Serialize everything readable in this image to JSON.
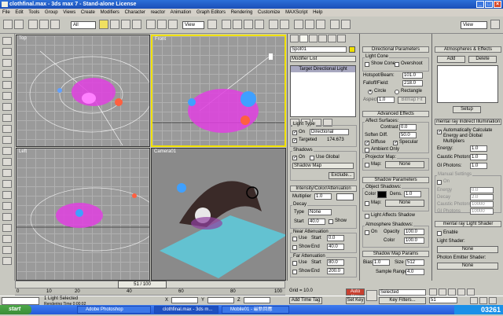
{
  "window": {
    "title": "clothfinal.max - 3ds max 7 - Stand-alone License"
  },
  "menu": [
    "File",
    "Edit",
    "Tools",
    "Group",
    "Views",
    "Create",
    "Modifiers",
    "Character",
    "reactor",
    "Animation",
    "Graph Editors",
    "Rendering",
    "Customize",
    "MAXScript",
    "Help"
  ],
  "toolbar": {
    "selection_filter": "All",
    "ref_coord": "View",
    "named_sel": "View"
  },
  "viewports": {
    "top": "Top",
    "front": "Front",
    "left": "Left",
    "camera": "Camera01"
  },
  "modify": {
    "object_name": "Spot01",
    "modifier_list": "Modifier List",
    "stack_item": "Target Directional Light",
    "light_type_header": "Light Type",
    "on_label": "On",
    "light_type_value": "Directional",
    "targeted_label": "Targeted",
    "targeted_value": "174.673",
    "shadows_header": "Shadows",
    "shadows_on_label": "On",
    "use_global_label": "Use Global",
    "shadow_type": "Shadow Map",
    "exclude_button": "Exclude...",
    "intensity_header": "Intensity/Color/Attenuation",
    "multiplier_label": "Multiplier",
    "multiplier_value": "1.0",
    "decay_label": "Decay",
    "type_label": "Type",
    "type_value": "None",
    "start_label": "Start",
    "start_value": "40.0",
    "show_label": "Show",
    "near_atten_label": "Near Attenuation",
    "use_label": "Use",
    "near_start": "0.0",
    "end_label": "End",
    "near_end": "40.0",
    "far_atten_label": "Far Attenuation",
    "far_start": "80.0",
    "far_end": "200.0"
  },
  "directional": {
    "header": "Directional Parameters",
    "light_cone": "Light Cone",
    "show_cone": "Show Cone",
    "overshoot": "Overshoot",
    "hotspot_label": "Hotspot/Beam:",
    "hotspot_value": "101.0",
    "falloff_label": "Falloff/Field:",
    "falloff_value": "218.0",
    "circle": "Circle",
    "rectangle": "Rectangle",
    "aspect_label": "Aspect:",
    "aspect_value": "1.0",
    "bitmap_fit": "Bitmap Fit",
    "adv_header": "Advanced Effects",
    "affect_surfaces": "Affect Surfaces:",
    "contrast_label": "Contrast",
    "contrast_value": "0.0",
    "soften_label": "Soften Diff.",
    "soften_value": "50.0",
    "diffuse": "Diffuse",
    "specular": "Specular",
    "ambient_only": "Ambient Only",
    "projector_map": "Projector Map:",
    "map_label": "Map:",
    "map_value": "None",
    "shadow_params_header": "Shadow Parameters",
    "object_shadows": "Object Shadows:",
    "color_label": "Color",
    "dens_label": "Dens.",
    "dens_value": "1.0",
    "map_none": "None",
    "light_affects": "Light Affects Shadow",
    "atmos_shadows": "Atmosphere Shadows:",
    "opacity_label": "Opacity",
    "opacity_value": "100.0",
    "color_amount": "Color",
    "color_amount_value": "100.0",
    "shadow_map_params": "Shadow Map Params",
    "bias_label": "Bias",
    "bias_value": "1.0",
    "size_label": "Size",
    "size_value": "512",
    "sample_range_label": "Sample Range",
    "sample_range_value": "4.0"
  },
  "rightpanel": {
    "atmos_header": "Atmospheres & Effects",
    "add": "Add",
    "delete": "Delete",
    "setup": "Setup",
    "mr_header": "mental ray Indirect Illumination",
    "auto_calc": "Automatically Calculate Energy and Global Multipliers",
    "energy_label": "Energy:",
    "energy_value": "1.0",
    "caustic_label": "Caustic Photons:",
    "caustic_value": "1.0",
    "gi_label": "GI Photons:",
    "gi_value": "1.0",
    "manual_header": "Manual Settings",
    "on": "On",
    "energy2": "Energy",
    "energy2_value": "0.0",
    "decay2": "Decay",
    "decay2_value": "2.0",
    "caustic2": "Caustic Photons",
    "caustic2_value": "10000",
    "gi2": "GI Photons",
    "gi2_value": "10000",
    "mr_shader_header": "mental ray Light Shader",
    "enable": "Enable",
    "light_shader": "Light Shader:",
    "light_shader_value": "None",
    "photon_emitter": "Photon Emitter Shader:",
    "photon_value": "None"
  },
  "timeline": {
    "slider_label": "51 / 100",
    "ticks": [
      "0",
      "10",
      "20",
      "40",
      "60",
      "80",
      "100"
    ]
  },
  "status": {
    "selected": "1 Light Selected",
    "render_time": "Rendering Time  0:00:02",
    "x_label": "X",
    "y_label": "Y",
    "z_label": "Z",
    "grid": "Grid = 10.0",
    "auto_key": "Auto Key",
    "set_key": "Set Key",
    "selected_dd": "Selected",
    "key_filters": "Key Filters...",
    "add_time_tag": "Add Time Tag",
    "frame": "51"
  },
  "taskbar": {
    "start": "start",
    "tasks": [
      "Adobe Photoshop",
      "clothfinal.max - 3ds m...",
      "Mobile01 - 最新回應"
    ],
    "watermark": "03261"
  },
  "colors": {
    "light_magenta": "#e040e0",
    "active_border": "#f0e000",
    "cloth": "#3a2a28"
  }
}
